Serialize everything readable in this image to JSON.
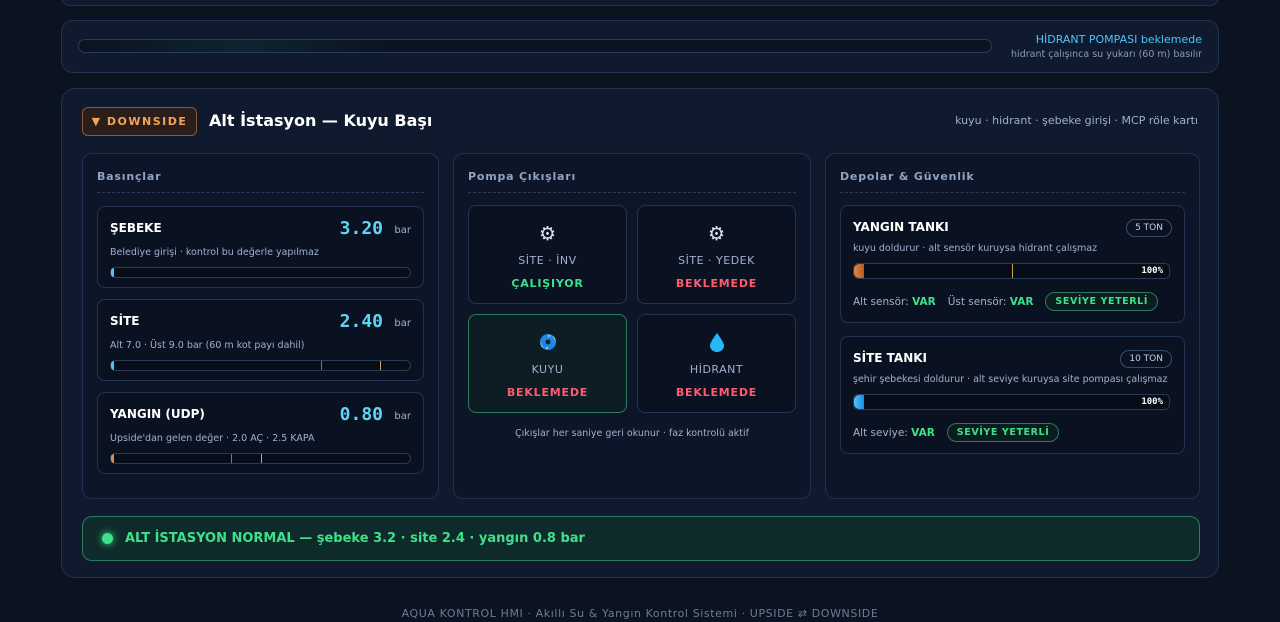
{
  "hydrant": {
    "status_line": "HİDRANT POMPASI beklemede",
    "info_line": "hidrant çalışınca su yukarı (60 m) basılır"
  },
  "panel": {
    "badge": "▼ DOWNSIDE",
    "title": "Alt İstasyon — Kuyu Başı",
    "subtitle": "kuyu · hidrant · şebeke girişi · MCP röle kartı"
  },
  "pressures": {
    "heading": "Basınçlar",
    "items": [
      {
        "name": "ŞEBEKE",
        "value": "3.20",
        "unit": "bar",
        "desc": "Belediye girişi · kontrol bu değerle yapılmaz",
        "level": 0.01,
        "color": "#4fc3f7"
      },
      {
        "name": "SİTE",
        "value": "2.40",
        "unit": "bar",
        "desc": "Alt 7.0 · Üst 9.0 bar (60 m kot payı dahil)",
        "level": 0.01,
        "color": "#4fc3f7"
      },
      {
        "name": "YANGIN (UDP)",
        "value": "0.80",
        "unit": "bar",
        "desc": "Upside'dan gelen değer · 2.0 AÇ · 2.5 KAPA",
        "level": 0.005,
        "color": "#e0884a"
      }
    ]
  },
  "pumps": {
    "heading": "Pompa Çıkışları",
    "items": [
      {
        "label": "SİTE · İNV",
        "state": "ÇALIŞIYOR",
        "icon": "gear-icon",
        "running": true
      },
      {
        "label": "SİTE · YEDEK",
        "state": "BEKLEMEDE",
        "icon": "gear-icon",
        "running": false
      },
      {
        "label": "KUYU",
        "state": "BEKLEMEDE",
        "icon": "swirl-icon",
        "running": false
      },
      {
        "label": "HİDRANT",
        "state": "BEKLEMEDE",
        "icon": "water-drop-icon",
        "running": false
      }
    ],
    "note": "Çıkışlar her saniye geri okunur · faz kontrolü aktif"
  },
  "tanks": {
    "heading": "Depolar & Güvenlik",
    "fire": {
      "name": "YANGIN TANKI",
      "capacity": "5 TON",
      "desc": "kuyu doldurur · alt sensör kuruysa hidrant çalışmaz",
      "percent": "100%",
      "lower_label": "Alt sensör:",
      "lower_value": "VAR",
      "upper_label": "Üst sensör:",
      "upper_value": "VAR",
      "status": "SEVİYE YETERLİ"
    },
    "site": {
      "name": "SİTE TANKI",
      "capacity": "10 TON",
      "desc": "şehir şebekesi doldurur · alt seviye kuruysa site pompası çalışmaz",
      "percent": "100%",
      "lower_label": "Alt seviye:",
      "lower_value": "VAR",
      "status": "SEVİYE YETERLİ"
    }
  },
  "status_bar": {
    "text": "ALT İSTASYON NORMAL — şebeke 3.2 · site 2.4 · yangın 0.8 bar"
  },
  "footer": {
    "text": "AQUA KONTROL HMI · Akıllı Su & Yangın Kontrol Sistemi · UPSIDE ⇄ DOWNSIDE"
  },
  "colors": {
    "accent": "#4fc3f7",
    "ok": "#3ee08a",
    "alarm": "#ff5a6e",
    "downside": "#f0a55a"
  }
}
